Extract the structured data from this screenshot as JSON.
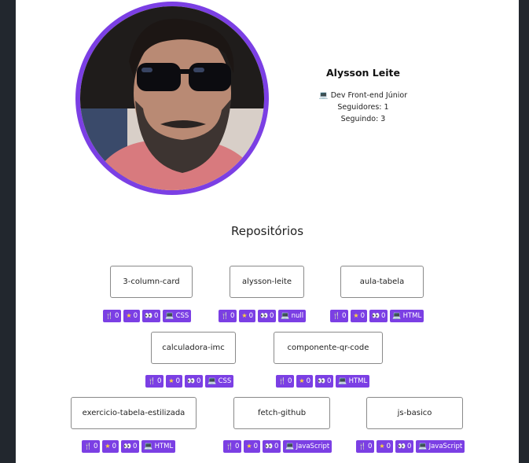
{
  "profile": {
    "name": "Alysson Leite",
    "bio_icon": "laptop-icon",
    "bio": "💻 Dev Front-end Júnior",
    "followers": "Seguidores: 1",
    "following": "Seguindo: 3"
  },
  "section_title": "Repositórios",
  "colors": {
    "accent": "#7b3fe4",
    "page_bg": "#ffffff",
    "frame_bg": "#22272e"
  },
  "badge_icons": [
    "fork-icon",
    "star-icon",
    "eyes-icon",
    "laptop-icon"
  ],
  "repos": [
    {
      "name": "3-column-card",
      "forks": "0",
      "stars": "0",
      "watchers": "0",
      "language": "CSS"
    },
    {
      "name": "alysson-leite",
      "forks": "0",
      "stars": "0",
      "watchers": "0",
      "language": "null"
    },
    {
      "name": "aula-tabela",
      "forks": "0",
      "stars": "0",
      "watchers": "0",
      "language": "HTML"
    },
    {
      "name": "calculadora-imc",
      "forks": "0",
      "stars": "0",
      "watchers": "0",
      "language": "CSS"
    },
    {
      "name": "componente-qr-code",
      "forks": "0",
      "stars": "0",
      "watchers": "0",
      "language": "HTML"
    },
    {
      "name": "exercicio-tabela-estilizada",
      "forks": "0",
      "stars": "0",
      "watchers": "0",
      "language": "HTML"
    },
    {
      "name": "fetch-github",
      "forks": "0",
      "stars": "0",
      "watchers": "0",
      "language": "JavaScript"
    },
    {
      "name": "js-basico",
      "forks": "0",
      "stars": "0",
      "watchers": "0",
      "language": "JavaScript"
    }
  ]
}
